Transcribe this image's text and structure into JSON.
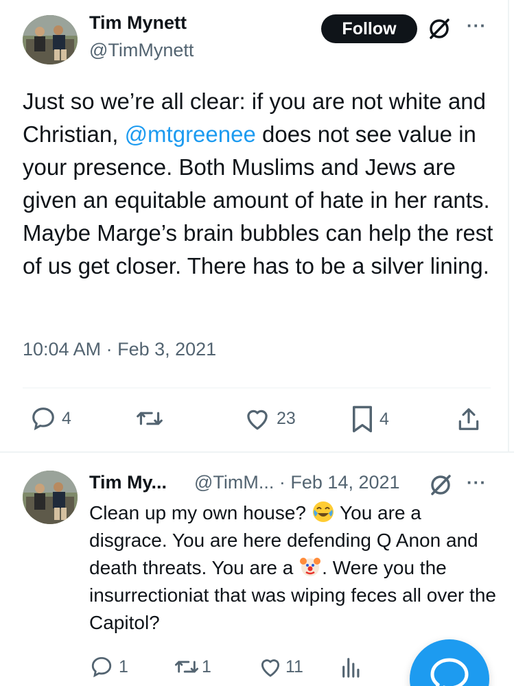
{
  "main_tweet": {
    "author_name": "Tim Mynett",
    "author_handle": "@TimMynett",
    "follow_label": "Follow",
    "text_before": "Just so we’re all clear: if you are not white and Christian, ",
    "mention": "@mtgreenee",
    "text_after": " does not see value in your presence.  Both Muslims and Jews are given an equitable amount of hate in her rants. Maybe Marge’s brain bubbles can help the rest of us get closer. There has to be a silver lining.",
    "timestamp": "10:04 AM · Feb 3, 2021",
    "actions": {
      "reply_count": "4",
      "retweet_count": "",
      "like_count": "23",
      "bookmark_count": "4"
    }
  },
  "reply_tweet": {
    "author_name": "Tim My...",
    "author_handle": "@TimM... · Feb 14, 2021",
    "text_1": "Clean up my own house? ",
    "text_2": " You are a disgrace. You are here defending Q Anon and death threats. You are a ",
    "text_3": ".  Were you the insurrectioniat that was wiping feces all over the Capitol?",
    "actions": {
      "reply_count": "1",
      "retweet_count": "1",
      "like_count": "11"
    }
  },
  "icons": [
    "grok-icon",
    "more-icon",
    "reply-icon",
    "retweet-icon",
    "like-icon",
    "bookmark-icon",
    "share-icon",
    "views-icon",
    "compose-icon",
    "joy-emoji",
    "clown-emoji"
  ],
  "colors": {
    "accent": "#1d9bf0",
    "text": "#0f1419",
    "muted": "#536471"
  }
}
